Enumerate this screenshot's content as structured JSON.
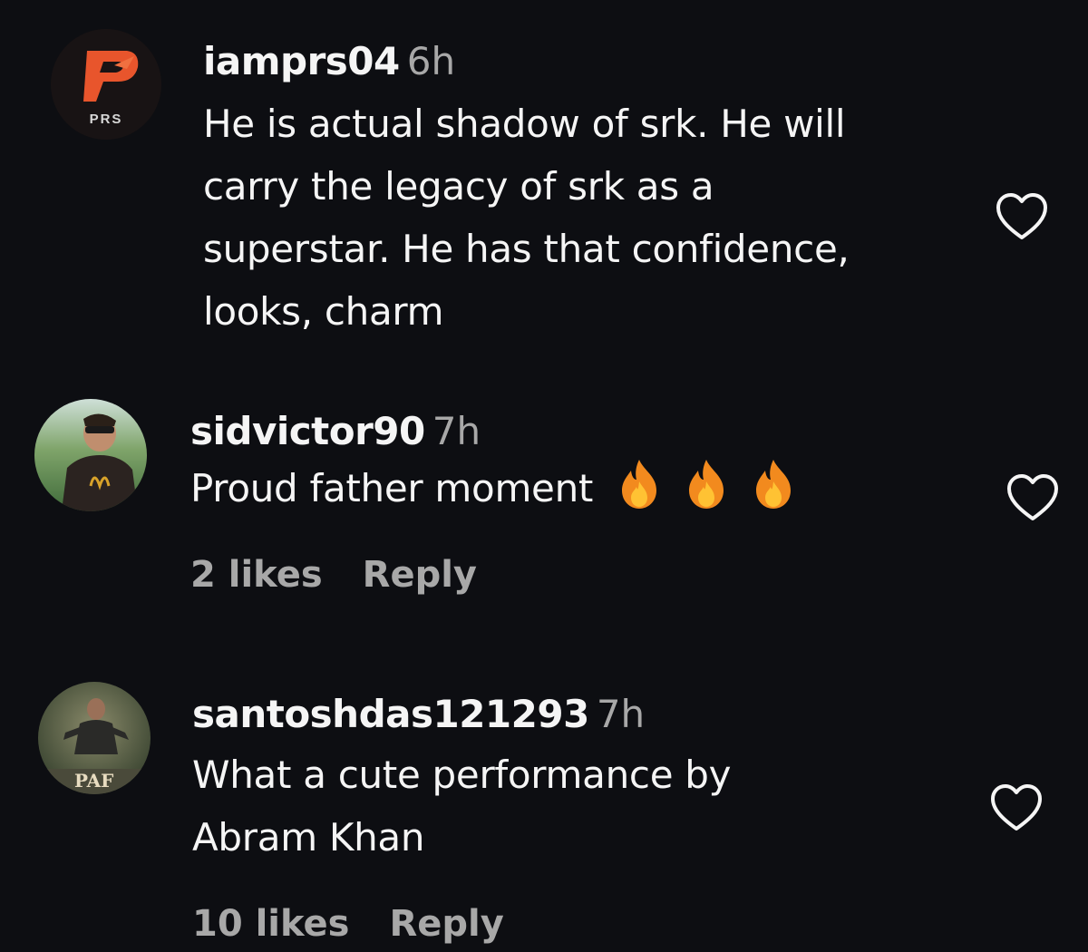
{
  "comments": [
    {
      "username": "iamprs04",
      "time": "6h",
      "lines": [
        "He is actual shadow of srk. He will",
        "carry the legacy of srk as a",
        "superstar. He has that confidence,",
        "looks, charm"
      ],
      "avatar": {
        "text": "PRS",
        "icon": "prs-logo-icon",
        "colors": {
          "bg": "#1a1414",
          "mark": "#e8552c"
        }
      }
    },
    {
      "username": "sidvictor90",
      "time": "7h",
      "text": "Proud father moment",
      "emojis": [
        "fire-icon",
        "fire-icon",
        "fire-icon"
      ],
      "likes": "2 likes",
      "reply": "Reply"
    },
    {
      "username": "santoshdas121293",
      "time": "7h",
      "lines": [
        "What a cute performance by",
        "Abram Khan"
      ],
      "likes": "10 likes",
      "reply": "Reply"
    }
  ],
  "colors": {
    "background": "#0d0e12",
    "text": "#f5f5f5",
    "muted": "#a8a8a8",
    "fire": "#f28a1e"
  }
}
